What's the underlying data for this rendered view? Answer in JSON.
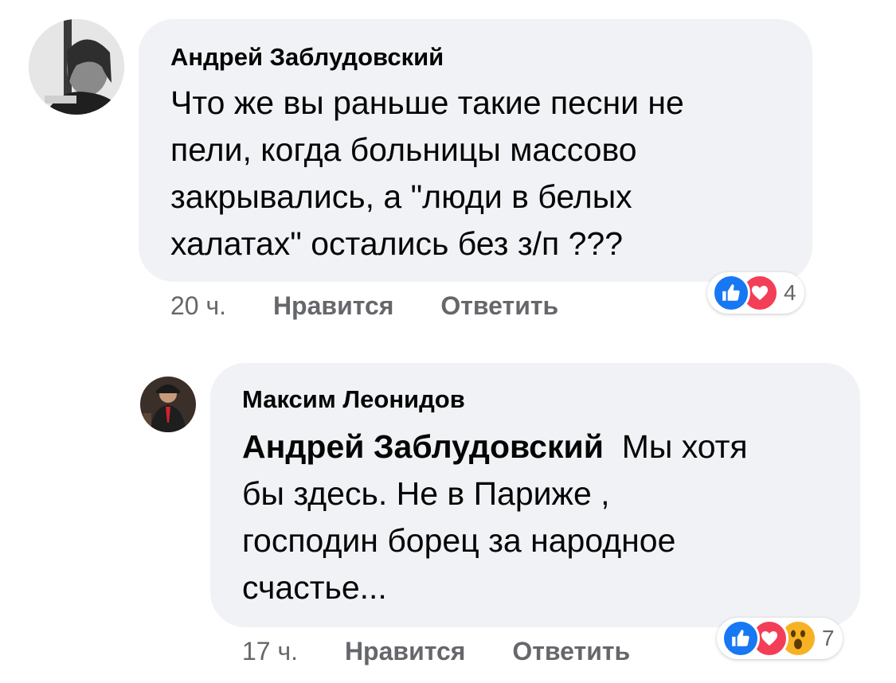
{
  "comments": [
    {
      "author": "Андрей Заблудовский",
      "lines": [
        "Что же вы раньше такие песни не",
        "пели, когда больницы массово",
        "закрывались, а \"люди в белых",
        "халатах\" остались без з/п ???"
      ],
      "time": "20 ч.",
      "like_label": "Нравится",
      "reply_label": "Ответить",
      "reaction_count": "4",
      "reactions": [
        "like-icon",
        "love-icon"
      ]
    },
    {
      "author": "Максим Леонидов",
      "mention": "Андрей Заблудовский",
      "first_line_rest": "Мы хотя",
      "lines": [
        "бы здесь. Не в Париже ,",
        "господин борец за народное",
        "счастье..."
      ],
      "time": "17 ч.",
      "like_label": "Нравится",
      "reply_label": "Ответить",
      "reaction_count": "7",
      "reactions": [
        "like-icon",
        "love-icon",
        "wow-icon"
      ]
    }
  ],
  "colors": {
    "bubble": "#f0f2f5",
    "like": "#1877f2",
    "love": "#f33e58",
    "wow": "#f7b125",
    "secondary_text": "#65676b"
  }
}
